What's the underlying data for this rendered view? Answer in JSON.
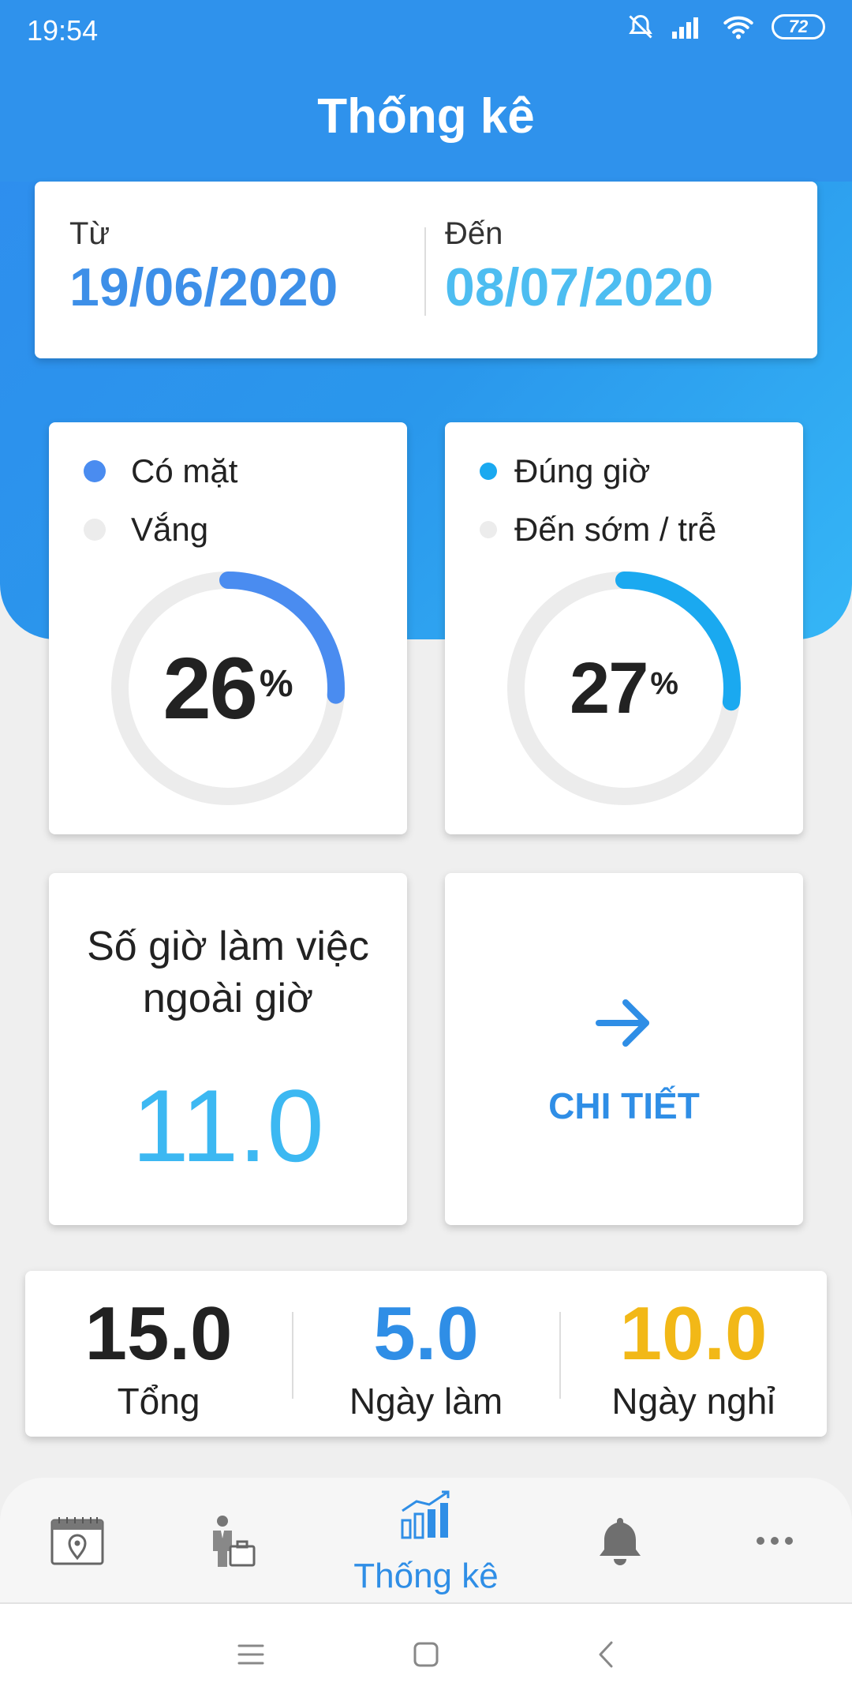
{
  "status_bar": {
    "time": "19:54",
    "battery": "72"
  },
  "header": {
    "title": "Thống kê"
  },
  "date_range": {
    "from_label": "Từ",
    "from_value": "19/06/2020",
    "to_label": "Đến",
    "to_value": "08/07/2020"
  },
  "attendance": {
    "legend_present": "Có mặt",
    "legend_absent": "Vắng",
    "percent": 26,
    "percent_text": "26",
    "percent_sign": "%",
    "color": "#4a8cf0"
  },
  "punctuality": {
    "legend_ontime": "Đúng giờ",
    "legend_early_late": "Đến sớm / trễ",
    "percent": 27,
    "percent_text": "27",
    "percent_sign": "%",
    "color": "#1aa9f0"
  },
  "overtime": {
    "title_line1": "Số giờ làm việc",
    "title_line2": "ngoài giờ",
    "value": "11.0"
  },
  "detail": {
    "label": "CHI TIẾT"
  },
  "totals": [
    {
      "value": "15.0",
      "label": "Tổng",
      "color": "#222222"
    },
    {
      "value": "5.0",
      "label": "Ngày làm",
      "color": "#2f8ee6"
    },
    {
      "value": "10.0",
      "label": "Ngày nghỉ",
      "color": "#f2b817"
    }
  ],
  "bottom_nav": {
    "items": [
      {
        "icon": "calendar-location-icon"
      },
      {
        "icon": "worker-briefcase-icon"
      },
      {
        "icon": "chart-icon",
        "label": "Thống kê",
        "active": true
      },
      {
        "icon": "bell-icon"
      },
      {
        "icon": "more-icon"
      }
    ]
  },
  "colors": {
    "primary": "#2f92ec",
    "accent": "#3cb8f2",
    "ring_track": "#ececec"
  }
}
